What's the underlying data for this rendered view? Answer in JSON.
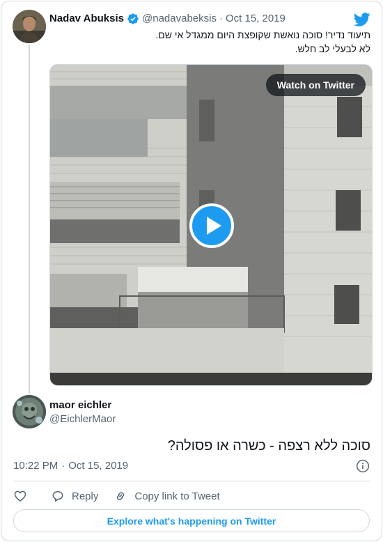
{
  "quoted_tweet": {
    "author_name": "Nadav Abuksis",
    "handle": "@nadavabeksis",
    "separator": "·",
    "date": "Oct 15, 2019",
    "text_line1": "תיעוד נדיר! סוכה נואשת שקופצת היום ממגדל אי שם.",
    "text_line2": "לא לבעלי לב חלש.",
    "watch_label": "Watch on Twitter",
    "icons": {
      "verified": "verified-badge-icon",
      "play": "play-icon",
      "logo": "twitter-bird-icon"
    }
  },
  "tweet": {
    "author_name": "maor eichler",
    "handle": "@EichlerMaor",
    "text": "סוכה ללא רצפה - כשרה או פסולה?",
    "time": "10:22 PM",
    "separator": "·",
    "date": "Oct 15, 2019"
  },
  "actions": {
    "reply_label": "Reply",
    "copy_link_label": "Copy link to Tweet"
  },
  "explore_label": "Explore what's happening on Twitter",
  "colors": {
    "accent": "#1d9bf0",
    "text": "#0f1419",
    "secondary": "#536471",
    "border": "#cfd9de"
  }
}
